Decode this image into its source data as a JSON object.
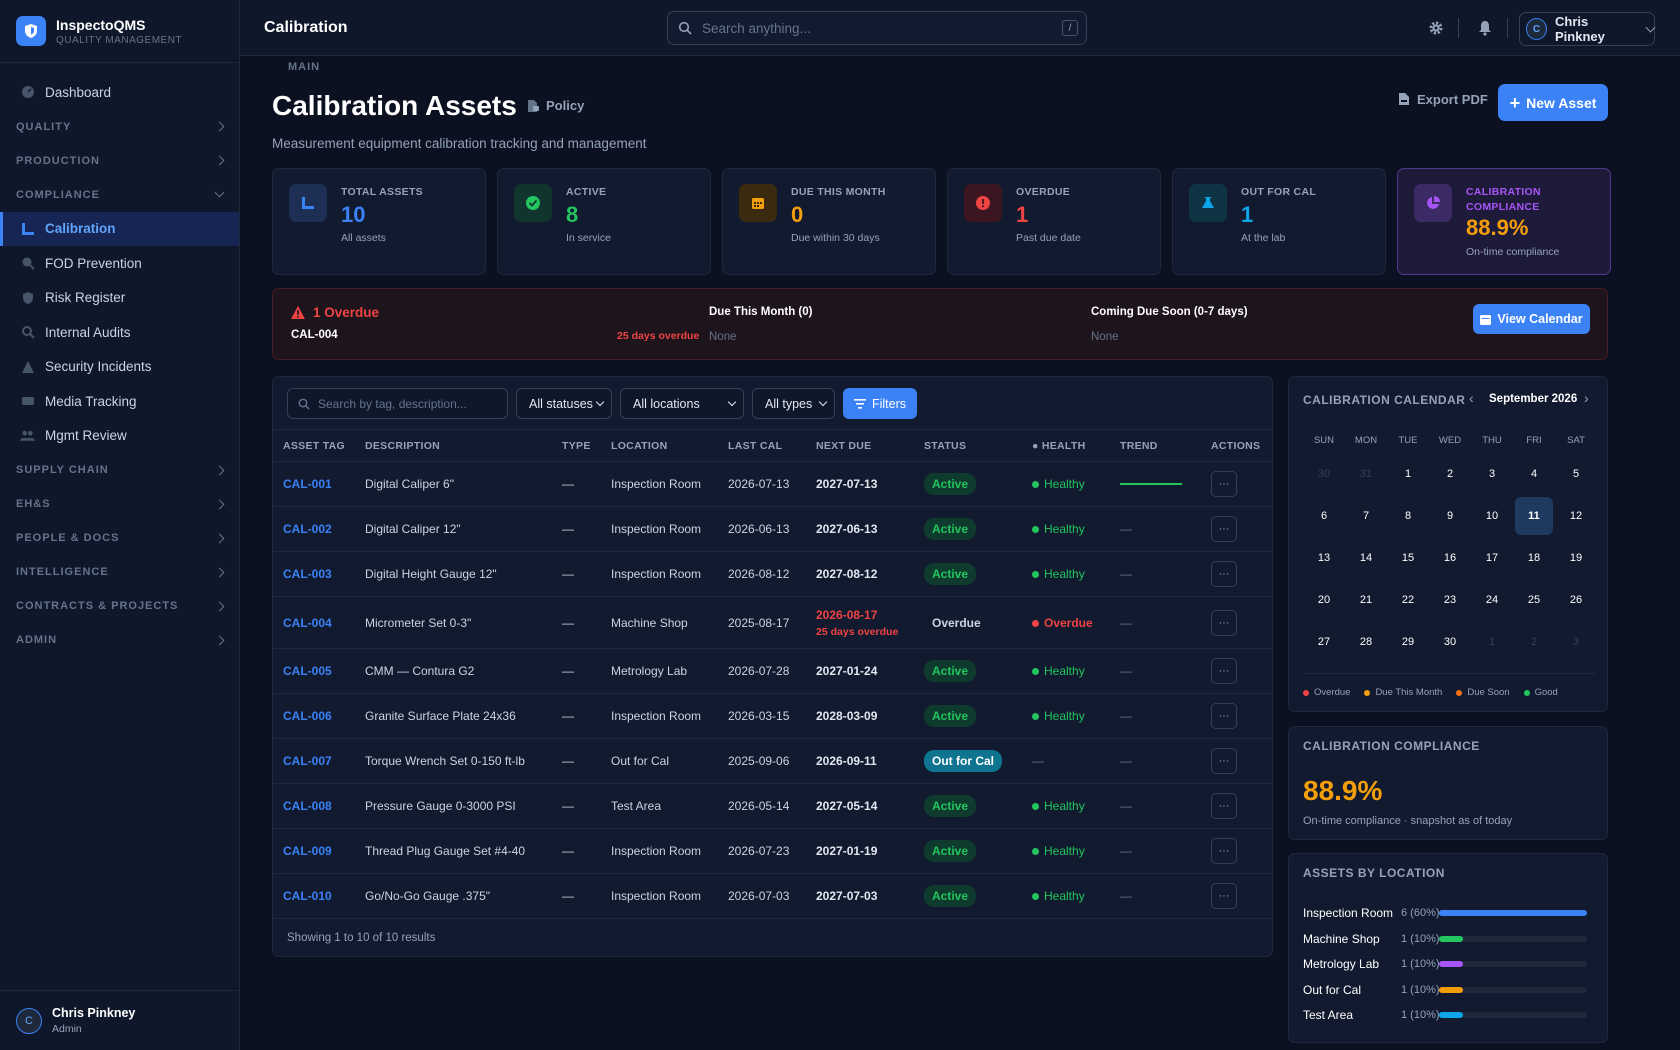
{
  "brand": {
    "name": "InspectoQMS",
    "sub": "QUALITY MANAGEMENT"
  },
  "nav": {
    "main_label": "MAIN",
    "dashboard": "Dashboard",
    "sections": [
      "QUALITY",
      "PRODUCTION",
      "COMPLIANCE"
    ],
    "compliance_items": [
      "Calibration",
      "FOD Prevention",
      "Risk Register",
      "Internal Audits",
      "Security Incidents",
      "Media Tracking",
      "Mgmt Review"
    ],
    "sections_after": [
      "SUPPLY CHAIN",
      "EH&S",
      "PEOPLE & DOCS",
      "INTELLIGENCE",
      "CONTRACTS & PROJECTS",
      "ADMIN"
    ]
  },
  "footer_user": {
    "initial": "C",
    "name": "Chris Pinkney",
    "role": "Admin"
  },
  "topbar": {
    "title": "Calibration",
    "search_placeholder": "Search anything...",
    "kbd": "/",
    "user": "Chris Pinkney",
    "user_initial": "C"
  },
  "page": {
    "title": "Calibration Assets",
    "policy": "Policy",
    "subtitle": "Measurement equipment calibration tracking and management",
    "export": "Export PDF",
    "new_asset": "New Asset"
  },
  "kpis": [
    {
      "label": "TOTAL ASSETS",
      "value": "10",
      "sub": "All assets",
      "color": "#3b82f6",
      "bg": "#1e2f55",
      "icon": "ruler-icon"
    },
    {
      "label": "ACTIVE",
      "value": "8",
      "sub": "In service",
      "color": "#22c55e",
      "bg": "#11352c",
      "icon": "check-circle-icon"
    },
    {
      "label": "DUE THIS MONTH",
      "value": "0",
      "sub": "Due within 30 days",
      "color": "#f59e0b",
      "bg": "#3a2a10",
      "icon": "calendar-icon"
    },
    {
      "label": "OVERDUE",
      "value": "1",
      "sub": "Past due date",
      "color": "#ef4444",
      "bg": "#3b1620",
      "icon": "alert-circle-icon"
    },
    {
      "label": "OUT FOR CAL",
      "value": "1",
      "sub": "At the lab",
      "color": "#0ea5e9",
      "bg": "#0f3444",
      "icon": "flask-icon"
    },
    {
      "label": "CALIBRATION COMPLIANCE",
      "value": "88.9%",
      "sub": "On-time compliance",
      "color": "#f59e0b",
      "label_color": "#a855f7",
      "bg": "#3b2a63",
      "icon": "pie-chart-icon"
    }
  ],
  "alert": {
    "overdue_title": "1 Overdue",
    "overdue_tag": "CAL-004",
    "overdue_days": "25 days overdue",
    "due_title": "Due This Month (0)",
    "due_value": "None",
    "soon_title": "Coming Due Soon (0-7 days)",
    "soon_value": "None",
    "button": "View Calendar"
  },
  "filters": {
    "search_placeholder": "Search by tag, description...",
    "status": "All statuses",
    "location": "All locations",
    "type": "All types",
    "button": "Filters"
  },
  "table": {
    "columns": [
      "ASSET TAG",
      "DESCRIPTION",
      "TYPE",
      "LOCATION",
      "LAST CAL",
      "NEXT DUE",
      "STATUS",
      "● HEALTH",
      "TREND",
      "ACTIONS"
    ],
    "rows": [
      {
        "tag": "CAL-001",
        "desc": "Digital Caliper 6\"",
        "type": "—",
        "loc": "Inspection Room",
        "last": "2026-07-13",
        "next": "2027-07-13",
        "status": "Active",
        "health": "Healthy",
        "trend": ""
      },
      {
        "tag": "CAL-002",
        "desc": "Digital Caliper 12\"",
        "type": "—",
        "loc": "Inspection Room",
        "last": "2026-06-13",
        "next": "2027-06-13",
        "status": "Active",
        "health": "Healthy",
        "trend": "—"
      },
      {
        "tag": "CAL-003",
        "desc": "Digital Height Gauge 12\"",
        "type": "—",
        "loc": "Inspection Room",
        "last": "2026-08-12",
        "next": "2027-08-12",
        "status": "Active",
        "health": "Healthy",
        "trend": "—"
      },
      {
        "tag": "CAL-004",
        "desc": "Micrometer Set 0-3\"",
        "type": "—",
        "loc": "Machine Shop",
        "last": "2025-08-17",
        "next": "2026-08-17",
        "next_note": "25 days overdue",
        "status": "Overdue",
        "health": "Overdue",
        "trend": "—"
      },
      {
        "tag": "CAL-005",
        "desc": "CMM — Contura G2",
        "type": "—",
        "loc": "Metrology Lab",
        "last": "2026-07-28",
        "next": "2027-01-24",
        "status": "Active",
        "health": "Healthy",
        "trend": "—"
      },
      {
        "tag": "CAL-006",
        "desc": "Granite Surface Plate 24x36",
        "type": "—",
        "loc": "Inspection Room",
        "last": "2026-03-15",
        "next": "2028-03-09",
        "status": "Active",
        "health": "Healthy",
        "trend": "—"
      },
      {
        "tag": "CAL-007",
        "desc": "Torque Wrench Set 0-150 ft-lb",
        "type": "—",
        "loc": "Out for Cal",
        "last": "2025-09-06",
        "next": "2026-09-11",
        "status": "Out for Cal",
        "health": "—",
        "trend": "—"
      },
      {
        "tag": "CAL-008",
        "desc": "Pressure Gauge 0-3000 PSI",
        "type": "—",
        "loc": "Test Area",
        "last": "2026-05-14",
        "next": "2027-05-14",
        "status": "Active",
        "health": "Healthy",
        "trend": "—"
      },
      {
        "tag": "CAL-009",
        "desc": "Thread Plug Gauge Set #4-40",
        "type": "—",
        "loc": "Inspection Room",
        "last": "2026-07-23",
        "next": "2027-01-19",
        "status": "Active",
        "health": "Healthy",
        "trend": "—"
      },
      {
        "tag": "CAL-010",
        "desc": "Go/No-Go Gauge .375\"",
        "type": "—",
        "loc": "Inspection Room",
        "last": "2026-07-03",
        "next": "2027-07-03",
        "status": "Active",
        "health": "Healthy",
        "trend": "—"
      }
    ],
    "footer": "Showing 1 to 10 of 10 results",
    "action_glyph": "···"
  },
  "calendar": {
    "title": "CALIBRATION CALENDAR",
    "month": "September 2026",
    "prev": "‹",
    "next": "›",
    "weekdays": [
      "SUN",
      "MON",
      "TUE",
      "WED",
      "THU",
      "FRI",
      "SAT"
    ],
    "days": [
      "30",
      "31",
      "1",
      "2",
      "3",
      "4",
      "5",
      "6",
      "7",
      "8",
      "9",
      "10",
      "11",
      "12",
      "13",
      "14",
      "15",
      "16",
      "17",
      "18",
      "19",
      "20",
      "21",
      "22",
      "23",
      "24",
      "25",
      "26",
      "27",
      "28",
      "29",
      "30",
      "1",
      "2",
      "3"
    ],
    "muted_days": [
      0,
      1,
      32,
      33,
      34
    ],
    "today_index": 12,
    "legend": [
      {
        "label": "Overdue",
        "color": "#ef4444"
      },
      {
        "label": "Due This Month",
        "color": "#f59e0b"
      },
      {
        "label": "Due Soon",
        "color": "#f97316"
      },
      {
        "label": "Good",
        "color": "#22c55e"
      }
    ]
  },
  "compliance_card": {
    "title": "CALIBRATION COMPLIANCE",
    "value": "88.9%",
    "sub": "On-time compliance · snapshot as of today"
  },
  "locations": {
    "title": "ASSETS BY LOCATION",
    "items": [
      {
        "name": "Inspection Room",
        "count": "6 (60%)",
        "fraction": 1.0,
        "color": "#3b82f6"
      },
      {
        "name": "Machine Shop",
        "count": "1 (10%)",
        "fraction": 0.16,
        "color": "#22c55e"
      },
      {
        "name": "Metrology Lab",
        "count": "1 (10%)",
        "fraction": 0.16,
        "color": "#a855f7"
      },
      {
        "name": "Out for Cal",
        "count": "1 (10%)",
        "fraction": 0.16,
        "color": "#f59e0b"
      },
      {
        "name": "Test Area",
        "count": "1 (10%)",
        "fraction": 0.16,
        "color": "#0ea5e9"
      }
    ]
  }
}
